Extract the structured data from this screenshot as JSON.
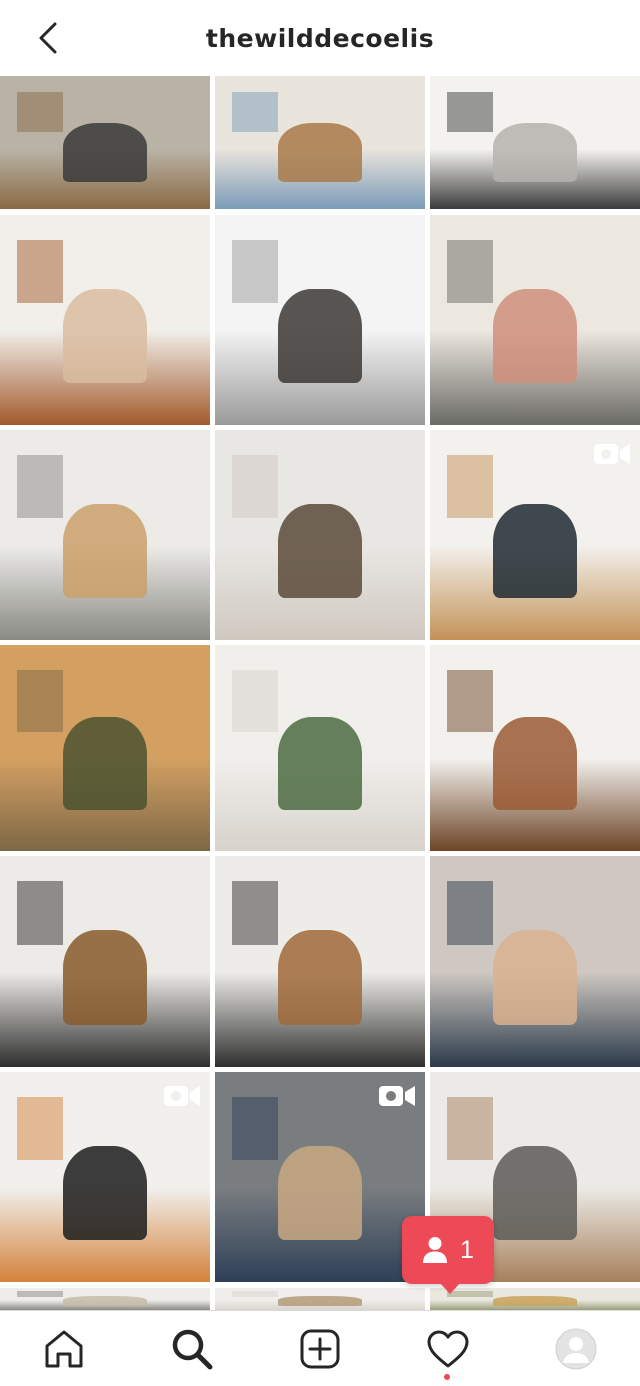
{
  "header": {
    "username": "thewilddecoelis",
    "back_icon": "chevron-left-icon"
  },
  "grid": {
    "posts": [
      {
        "name": "post-house-exterior",
        "colors": [
          "#b9b3a6",
          "#3a3a3a",
          "#8b6a45"
        ],
        "video": false
      },
      {
        "name": "post-family-breakfast",
        "colors": [
          "#e9e4dc",
          "#a97a4a",
          "#7b9bb8"
        ],
        "video": false
      },
      {
        "name": "post-kitchen-counter",
        "colors": [
          "#f3f2ef",
          "#b5b3ae",
          "#3b3b3b"
        ],
        "video": false
      },
      {
        "name": "post-bedroom",
        "colors": [
          "#f1efea",
          "#d9bca0",
          "#a35a2c"
        ],
        "video": false
      },
      {
        "name": "post-snowy-cabin",
        "colors": [
          "#f4f4f4",
          "#3b3735",
          "#9a9a9a"
        ],
        "video": false
      },
      {
        "name": "post-mother-daughter-window",
        "colors": [
          "#ece7df",
          "#d08e7b",
          "#6a6a65"
        ],
        "video": false
      },
      {
        "name": "post-mudroom-bench",
        "colors": [
          "#ecebe8",
          "#caa06a",
          "#8a8a84"
        ],
        "video": false
      },
      {
        "name": "post-snowy-forest",
        "colors": [
          "#e9e7e4",
          "#5a4a3a",
          "#cfc8bf"
        ],
        "video": false
      },
      {
        "name": "post-dining-nook",
        "colors": [
          "#f3f1ed",
          "#1f2a33",
          "#c39258"
        ],
        "video": true
      },
      {
        "name": "post-sunset-field",
        "colors": [
          "#d3a062",
          "#4a5230",
          "#7d6845"
        ],
        "video": false
      },
      {
        "name": "post-guest-room",
        "colors": [
          "#f1efec",
          "#4d6b42",
          "#d7d2cb"
        ],
        "video": false
      },
      {
        "name": "post-leather-chair",
        "colors": [
          "#f3f1ee",
          "#9a5a34",
          "#6d4426"
        ],
        "video": false
      },
      {
        "name": "post-dining-room",
        "colors": [
          "#ecebe8",
          "#8a5a2c",
          "#2e2e2e"
        ],
        "video": false
      },
      {
        "name": "post-living-room",
        "colors": [
          "#eeece8",
          "#a06a3a",
          "#2f2f2f"
        ],
        "video": false
      },
      {
        "name": "post-family-selfie",
        "colors": [
          "#cfc8c2",
          "#d9b28e",
          "#2b3a4a"
        ],
        "video": false
      },
      {
        "name": "post-fireplace",
        "colors": [
          "#f1f0ed",
          "#1c1c1c",
          "#d4823b"
        ],
        "video": true
      },
      {
        "name": "post-couple-portrait",
        "colors": [
          "#7a7d80",
          "#c9a883",
          "#2e3f57"
        ],
        "video": true
      },
      {
        "name": "post-laundry-room",
        "colors": [
          "#eceae6",
          "#5d5a57",
          "#a7805c"
        ],
        "video": false
      },
      {
        "name": "post-row7-a",
        "colors": [
          "#efedea",
          "#c7bba8",
          "#8a8a84"
        ],
        "video": false
      },
      {
        "name": "post-row7-b",
        "colors": [
          "#f0eeeb",
          "#b39a78",
          "#d8d4ce"
        ],
        "video": false
      },
      {
        "name": "post-row7-c",
        "colors": [
          "#eae7df",
          "#c9a25a",
          "#9aa07a"
        ],
        "video": false
      }
    ]
  },
  "notification": {
    "icon": "person-icon",
    "count": "1",
    "color": "#ed4956"
  },
  "tabbar": {
    "items": [
      {
        "name": "tab-home",
        "icon": "home-icon"
      },
      {
        "name": "tab-search",
        "icon": "search-icon",
        "active": true
      },
      {
        "name": "tab-new-post",
        "icon": "plus-square-icon"
      },
      {
        "name": "tab-activity",
        "icon": "heart-icon"
      },
      {
        "name": "tab-profile",
        "icon": "avatar-icon"
      }
    ]
  }
}
